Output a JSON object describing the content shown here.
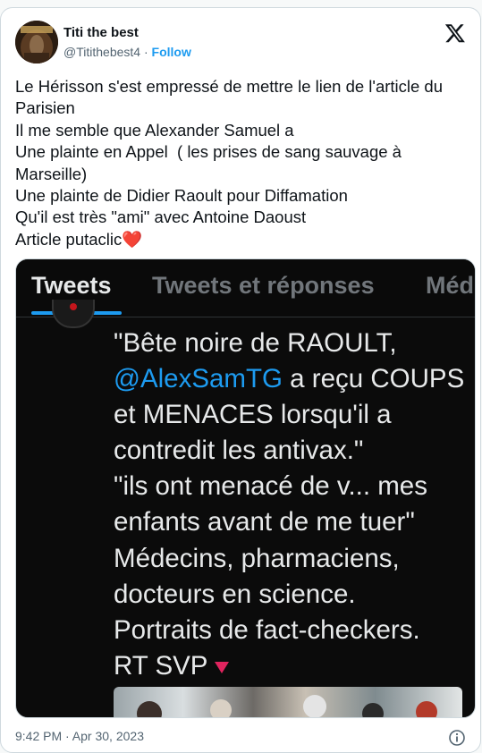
{
  "author": {
    "name": "Titi the best",
    "handle": "@Titithebest4",
    "separator": " · ",
    "follow_label": "Follow",
    "avatar_icon": "profile-avatar",
    "platform_icon": "x-logo-icon"
  },
  "tweet": {
    "text": "Le Hérisson s'est empressé de mettre le lien de l'article du Parisien\nIl me semble que Alexander Samuel a\nUne plainte en Appel  ( les prises de sang sauvage à Marseille)\nUne plainte de Didier Raoult pour Diffamation\nQu'il est très \"ami\" avec Antoine Daoust\nArticle putaclic",
    "emoji": "❤️"
  },
  "media": {
    "tabs": [
      "Tweets",
      "Tweets et réponses",
      "Méd"
    ],
    "active_tab": "Tweets",
    "quote_lines": [
      "\"Bête noire de RAOULT,",
      "@AlexSamTG",
      " a reçu COUPS",
      "et MENACES lorsqu'il a",
      "contredit les antivax.\"",
      "\"ils ont menacé de v... mes",
      "enfants avant de me tuer\"",
      "Médecins, pharmaciens,",
      "docteurs en science.",
      "Portraits de fact-checkers.",
      "RT SVP"
    ],
    "mention_color": "#1d9bf0"
  },
  "footer": {
    "timestamp": "9:42 PM · Apr 30, 2023",
    "info_icon": "info-icon"
  }
}
